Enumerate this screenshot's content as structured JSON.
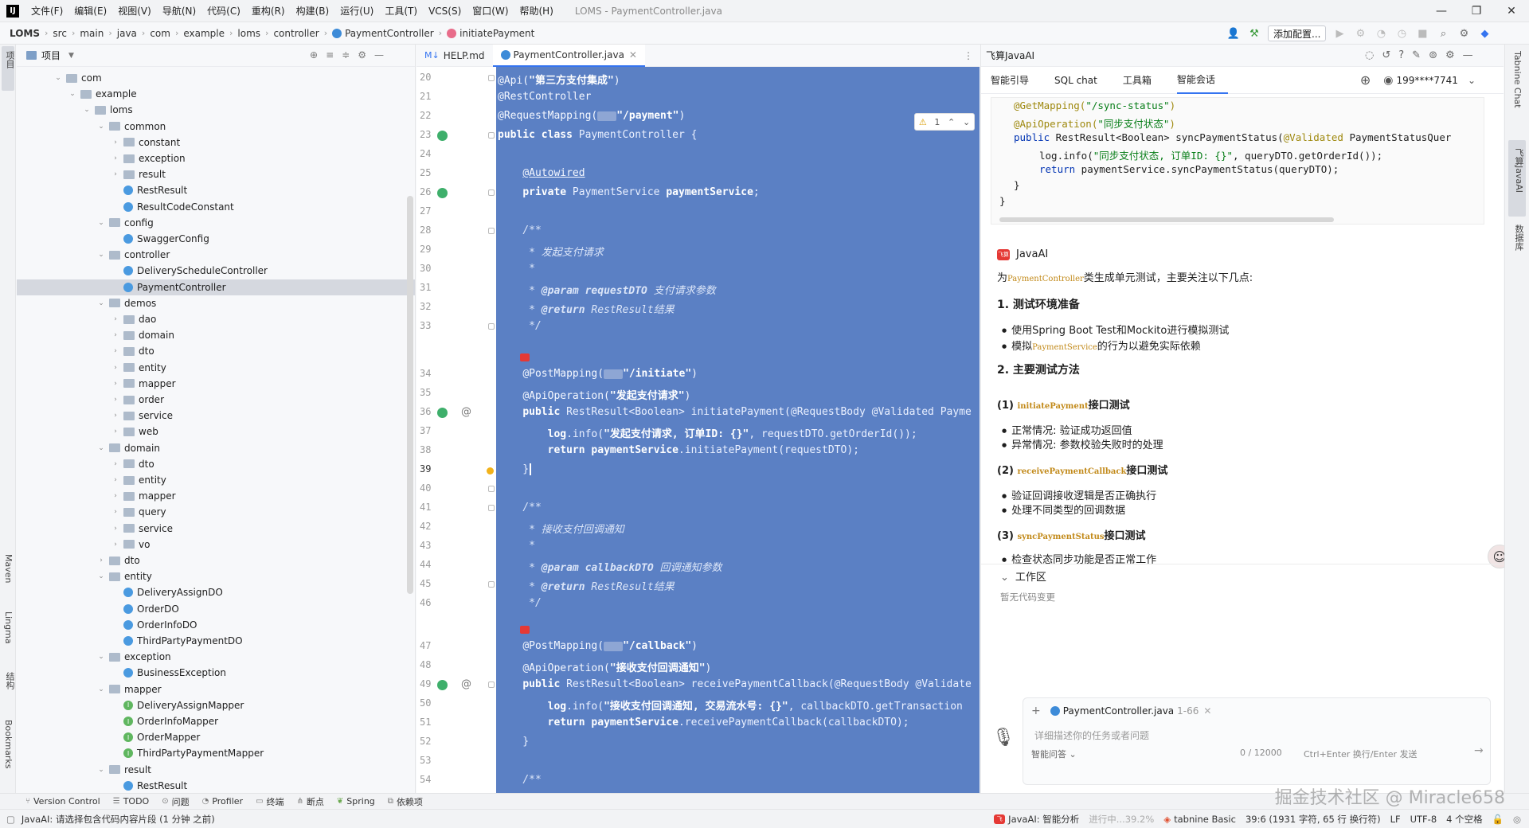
{
  "menubar": {
    "logo": "IJ",
    "items": [
      "文件(F)",
      "编辑(E)",
      "视图(V)",
      "导航(N)",
      "代码(C)",
      "重构(R)",
      "构建(B)",
      "运行(U)",
      "工具(T)",
      "VCS(S)",
      "窗口(W)",
      "帮助(H)"
    ],
    "window_title": "LOMS - PaymentController.java"
  },
  "breadcrumb": [
    "LOMS",
    "src",
    "main",
    "java",
    "com",
    "example",
    "loms",
    "controller",
    "PaymentController",
    "initiatePayment"
  ],
  "toolbar": {
    "add_config": "添加配置..."
  },
  "left_strip": {
    "project": "项目",
    "maven": "Maven",
    "lingma": "Lingma",
    "structure": "结构",
    "bookmarks": "Bookmarks"
  },
  "project_panel": {
    "title": "项目",
    "tree": [
      {
        "label": "com",
        "type": "folder",
        "depth": 0,
        "open": true
      },
      {
        "label": "example",
        "type": "folder",
        "depth": 1,
        "open": true
      },
      {
        "label": "loms",
        "type": "folder",
        "depth": 2,
        "open": true
      },
      {
        "label": "common",
        "type": "folder",
        "depth": 3,
        "open": true
      },
      {
        "label": "constant",
        "type": "folder",
        "depth": 4,
        "open": false
      },
      {
        "label": "exception",
        "type": "folder",
        "depth": 4,
        "open": false
      },
      {
        "label": "result",
        "type": "folder",
        "depth": 4,
        "open": false
      },
      {
        "label": "RestResult",
        "type": "class",
        "depth": 4
      },
      {
        "label": "ResultCodeConstant",
        "type": "class",
        "depth": 4
      },
      {
        "label": "config",
        "type": "folder",
        "depth": 3,
        "open": true
      },
      {
        "label": "SwaggerConfig",
        "type": "class",
        "depth": 4
      },
      {
        "label": "controller",
        "type": "folder",
        "depth": 3,
        "open": true
      },
      {
        "label": "DeliveryScheduleController",
        "type": "class",
        "depth": 4
      },
      {
        "label": "PaymentController",
        "type": "class",
        "depth": 4,
        "selected": true
      },
      {
        "label": "demos",
        "type": "folder",
        "depth": 3,
        "open": true
      },
      {
        "label": "dao",
        "type": "folder",
        "depth": 4,
        "open": false
      },
      {
        "label": "domain",
        "type": "folder",
        "depth": 4,
        "open": false
      },
      {
        "label": "dto",
        "type": "folder",
        "depth": 4,
        "open": false
      },
      {
        "label": "entity",
        "type": "folder",
        "depth": 4,
        "open": false
      },
      {
        "label": "mapper",
        "type": "folder",
        "depth": 4,
        "open": false
      },
      {
        "label": "order",
        "type": "folder",
        "depth": 4,
        "open": false
      },
      {
        "label": "service",
        "type": "folder",
        "depth": 4,
        "open": false
      },
      {
        "label": "web",
        "type": "folder",
        "depth": 4,
        "open": false
      },
      {
        "label": "domain",
        "type": "folder",
        "depth": 3,
        "open": true
      },
      {
        "label": "dto",
        "type": "folder",
        "depth": 4,
        "open": false
      },
      {
        "label": "entity",
        "type": "folder",
        "depth": 4,
        "open": false
      },
      {
        "label": "mapper",
        "type": "folder",
        "depth": 4,
        "open": false
      },
      {
        "label": "query",
        "type": "folder",
        "depth": 4,
        "open": false
      },
      {
        "label": "service",
        "type": "folder",
        "depth": 4,
        "open": false
      },
      {
        "label": "vo",
        "type": "folder",
        "depth": 4,
        "open": false
      },
      {
        "label": "dto",
        "type": "folder",
        "depth": 3,
        "open": false
      },
      {
        "label": "entity",
        "type": "folder",
        "depth": 3,
        "open": true
      },
      {
        "label": "DeliveryAssignDO",
        "type": "class",
        "depth": 4
      },
      {
        "label": "OrderDO",
        "type": "class",
        "depth": 4
      },
      {
        "label": "OrderInfoDO",
        "type": "class",
        "depth": 4
      },
      {
        "label": "ThirdPartyPaymentDO",
        "type": "class",
        "depth": 4
      },
      {
        "label": "exception",
        "type": "folder",
        "depth": 3,
        "open": true
      },
      {
        "label": "BusinessException",
        "type": "class",
        "depth": 4
      },
      {
        "label": "mapper",
        "type": "folder",
        "depth": 3,
        "open": true
      },
      {
        "label": "DeliveryAssignMapper",
        "type": "interface",
        "depth": 4
      },
      {
        "label": "OrderInfoMapper",
        "type": "interface",
        "depth": 4
      },
      {
        "label": "OrderMapper",
        "type": "interface",
        "depth": 4
      },
      {
        "label": "ThirdPartyPaymentMapper",
        "type": "interface",
        "depth": 4
      },
      {
        "label": "result",
        "type": "folder",
        "depth": 3,
        "open": true
      },
      {
        "label": "RestResult",
        "type": "class",
        "depth": 4
      }
    ]
  },
  "editor": {
    "tabs": [
      {
        "label": "HELP.md",
        "active": false
      },
      {
        "label": "PaymentController.java",
        "active": true
      }
    ],
    "warning_count": "1",
    "line_numbers": [
      "20",
      "21",
      "22",
      "23",
      "24",
      "25",
      "26",
      "27",
      "28",
      "29",
      "30",
      "31",
      "32",
      "33",
      "34",
      "35",
      "36",
      "37",
      "38",
      "39",
      "40",
      "41",
      "42",
      "43",
      "44",
      "45",
      "46",
      "47",
      "48",
      "49",
      "50",
      "51",
      "52",
      "53",
      "54"
    ],
    "current_line": "39"
  },
  "ai_panel": {
    "title": "飞算JavaAI",
    "tabs": [
      "智能引导",
      "SQL chat",
      "工具箱",
      "智能会话"
    ],
    "account": "199****7741",
    "reply_name": "JavaAI",
    "intro_pre": "为",
    "intro_code": "PaymentController",
    "intro_post": "类生成单元测试，主要关注以下几点:",
    "h1": "1. 测试环境准备",
    "b1": "使用Spring Boot Test和Mockito进行模拟测试",
    "b2_pre": "模拟",
    "b2_code": "PaymentService",
    "b2_post": "的行为以避免实际依赖",
    "h2": "2. 主要测试方法",
    "s1_pre": "(1) ",
    "s1_code": "initiatePayment",
    "s1_post": "接口测试",
    "s1b1": "正常情况: 验证成功返回值",
    "s1b2": "异常情况: 参数校验失败时的处理",
    "s2_pre": "(2) ",
    "s2_code": "receivePaymentCallback",
    "s2_post": "接口测试",
    "s2b1": "验证回调接收逻辑是否正确执行",
    "s2b2": "处理不同类型的回调数据",
    "s3_pre": "(3) ",
    "s3_code": "syncPaymentStatus",
    "s3_post": "接口测试",
    "s3b1": "检查状态同步功能是否正常工作",
    "workspace_label": "工作区",
    "workspace_empty": "暂无代码变更",
    "context_file": "PaymentController.java",
    "context_range": "1-66",
    "input_placeholder": "详细描述你的任务或者问题",
    "mode": "智能问答",
    "char_count": "0 / 12000",
    "send_hint": "Ctrl+Enter 换行/Enter 发送"
  },
  "right_strip": {
    "tabnine": "Tabnine Chat",
    "javaai": "飞算JavaAI",
    "db": "数据库"
  },
  "bottom_tools": [
    "Version Control",
    "TODO",
    "问题",
    "Profiler",
    "终端",
    "断点",
    "Spring",
    "依赖项"
  ],
  "status_bar": {
    "message": "JavaAI: 请选择包含代码内容片段 (1 分钟 之前)",
    "ai_status": "JavaAI: 智能分析",
    "progress": "进行中...39.2%",
    "tabnine": "tabnine Basic",
    "position": "39:6 (1931 字符, 65 行 换行符)",
    "line_sep": "LF",
    "encoding": "UTF-8",
    "indent": "4 个空格"
  },
  "watermark": "掘金技术社区 @ Miracle658"
}
